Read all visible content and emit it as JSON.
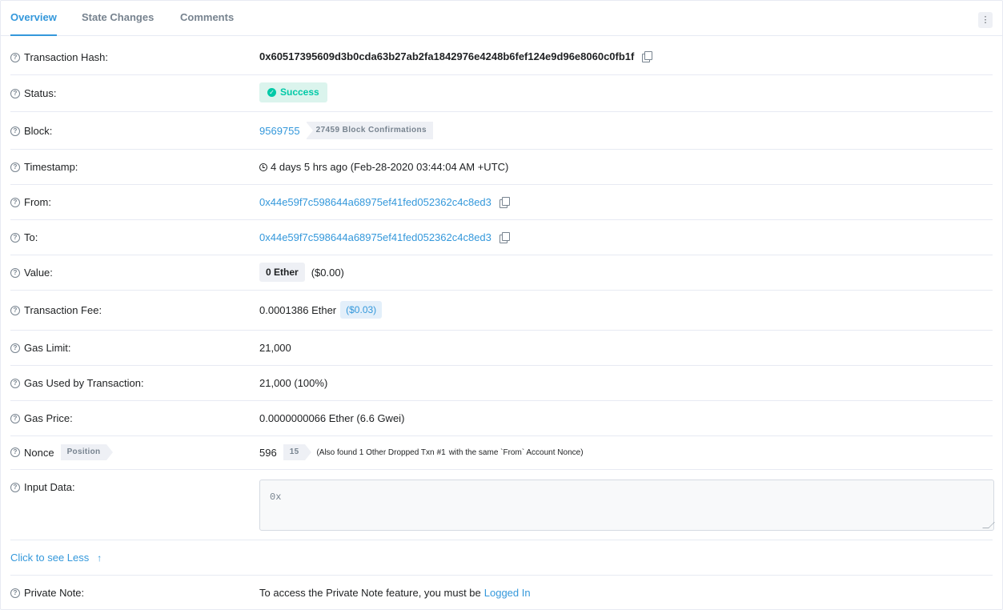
{
  "tabs": [
    {
      "label": "Overview"
    },
    {
      "label": "State Changes"
    },
    {
      "label": "Comments"
    }
  ],
  "more_menu_glyph": "⋮",
  "rows": {
    "tx_hash": {
      "label": "Transaction Hash:",
      "value": "0x60517395609d3b0cda63b27ab2fa1842976e4248b6fef124e9d96e8060c0fb1f"
    },
    "status": {
      "label": "Status:",
      "value": "Success"
    },
    "block": {
      "label": "Block:",
      "value": "9569755",
      "confirmations": "27459 Block Confirmations"
    },
    "timestamp": {
      "label": "Timestamp:",
      "value": "4 days 5 hrs ago (Feb-28-2020 03:44:04 AM +UTC)"
    },
    "from": {
      "label": "From:",
      "value": "0x44e59f7c598644a68975ef41fed052362c4c8ed3"
    },
    "to": {
      "label": "To:",
      "value": "0x44e59f7c598644a68975ef41fed052362c4c8ed3"
    },
    "value": {
      "label": "Value:",
      "amount": "0 Ether",
      "usd": "($0.00)"
    },
    "fee": {
      "label": "Transaction Fee:",
      "amount": "0.0001386 Ether",
      "usd": "($0.03)"
    },
    "gas_limit": {
      "label": "Gas Limit:",
      "value": "21,000"
    },
    "gas_used": {
      "label": "Gas Used by Transaction:",
      "value": "21,000 (100%)"
    },
    "gas_price": {
      "label": "Gas Price:",
      "value": "0.0000000066 Ether (6.6 Gwei)"
    },
    "nonce": {
      "label": "Nonce",
      "position_badge": "Position",
      "value": "596",
      "position": "15",
      "note_prefix": "(Also found 1 Other Dropped Txn",
      "note_link": "#1",
      "note_suffix": "with the same `From` Account Nonce)"
    },
    "input_data": {
      "label": "Input Data:",
      "value": "0x"
    },
    "see_less": {
      "label": "Click to see Less",
      "arrow": "↑"
    },
    "private_note": {
      "label": "Private Note:",
      "text": "To access the Private Note feature, you must be",
      "link": "Logged In"
    }
  },
  "colors": {
    "accent": "#3498db",
    "success": "#00c9a7",
    "success_bg": "#dbf4ed",
    "border": "#e7eaf3",
    "muted": "#77838f"
  }
}
